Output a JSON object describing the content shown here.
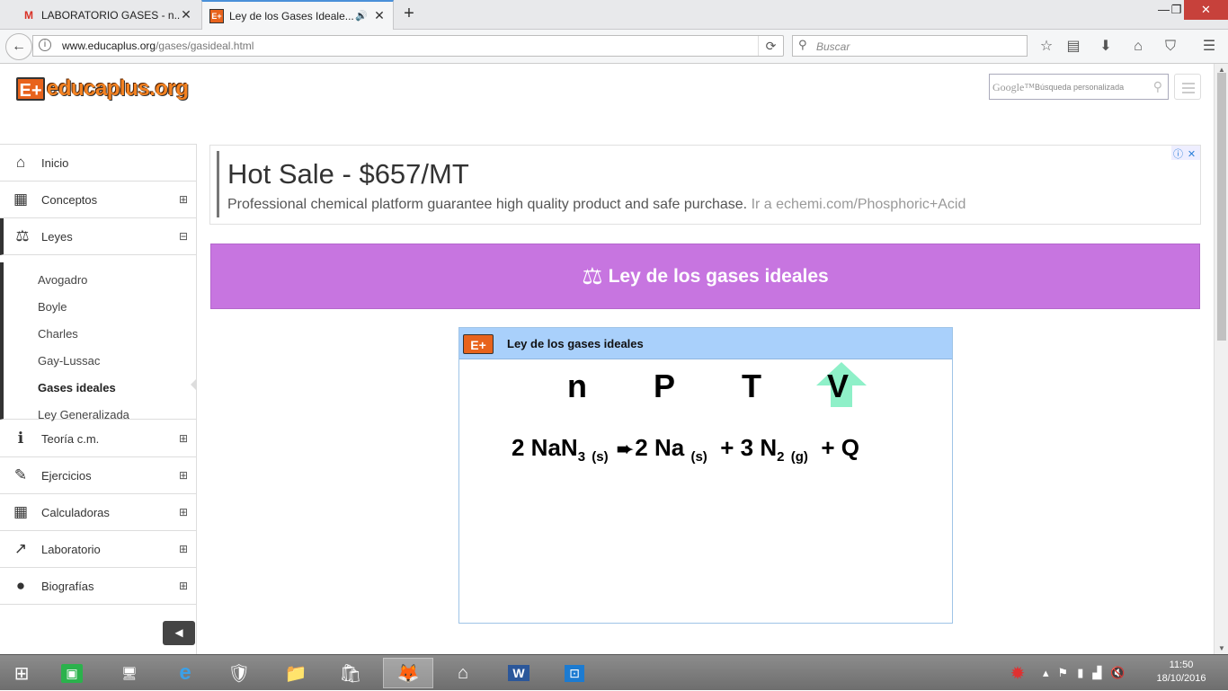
{
  "browser": {
    "tabs": [
      {
        "title": "LABORATORIO GASES - n...",
        "favicon": "gmail-icon"
      },
      {
        "title": "Ley de los Gases Ideale...",
        "favicon": "educaplus-icon",
        "audio": true
      }
    ],
    "new_tab": "+",
    "url_domain": "www.educaplus.org",
    "url_path": "/gases/gasideal.html",
    "search_placeholder": "Buscar"
  },
  "site": {
    "logo_mark": "E+",
    "logo_text": "educaplus.org",
    "google_label": "Google™",
    "google_placeholder": "Búsqueda personalizada"
  },
  "sidebar": {
    "items": [
      {
        "label": "Inicio",
        "icon": "home-icon"
      },
      {
        "label": "Conceptos",
        "icon": "calendar-icon",
        "expander": "⊞"
      },
      {
        "label": "Leyes",
        "icon": "balance-icon",
        "expander": "⊟"
      },
      {
        "label": "Teoría c.m.",
        "icon": "info-icon",
        "expander": "⊞"
      },
      {
        "label": "Ejercicios",
        "icon": "pencil-icon",
        "expander": "⊞"
      },
      {
        "label": "Calculadoras",
        "icon": "calculator-icon",
        "expander": "⊞"
      },
      {
        "label": "Laboratorio",
        "icon": "chart-line-icon",
        "expander": "⊞"
      },
      {
        "label": "Biografías",
        "icon": "user-icon",
        "expander": "⊞"
      }
    ],
    "subitems": [
      "Avogadro",
      "Boyle",
      "Charles",
      "Gay-Lussac",
      "Gases ideales",
      "Ley Generalizada"
    ],
    "selected_subitem": "Gases ideales"
  },
  "ad": {
    "title": "Hot Sale - $657/MT",
    "description": "Professional chemical platform guarantee high quality product and safe purchase.",
    "link": "Ir a echemi.com/Phosphoric+Acid"
  },
  "banner": {
    "title": "Ley de los gases ideales"
  },
  "simulation": {
    "title": "Ley de los gases ideales",
    "variables": [
      "n",
      "P",
      "T",
      "V"
    ],
    "increasing_variable": "V",
    "equation": {
      "c1": "2 NaN",
      "s1": "3",
      "st1": "(s)",
      "c2": "2 Na",
      "st2": "(s)",
      "c3": "+ 3 N",
      "s3": "2",
      "st3": "(g)",
      "c4": "+ Q"
    }
  },
  "taskbar": {
    "time": "11:50",
    "date": "18/10/2016"
  },
  "colors": {
    "banner": "#c775e0",
    "sim_header": "#a9d0fb",
    "arrow": "#8ef0c8",
    "logo_orange": "#f48221"
  }
}
